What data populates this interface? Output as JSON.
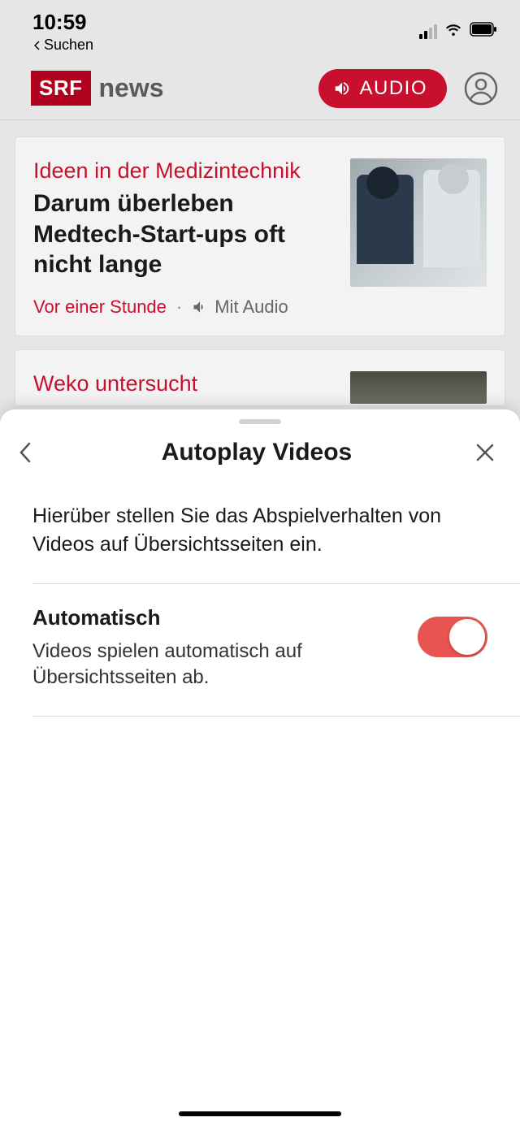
{
  "status": {
    "time": "10:59",
    "back_label": "Suchen"
  },
  "header": {
    "logo_box": "SRF",
    "logo_text": "news",
    "audio_label": "AUDIO"
  },
  "articles": [
    {
      "kicker": "Ideen in der Medizintechnik",
      "headline": "Darum überleben Medtech-Start-ups oft nicht lange",
      "time": "Vor einer Stunde",
      "audio_label": "Mit Audio"
    },
    {
      "kicker": "Weko untersucht"
    }
  ],
  "sheet": {
    "title": "Autoplay Videos",
    "description": "Hierüber stellen Sie das Abspielverhalten von Videos auf Übersichtsseiten ein.",
    "setting_title": "Automatisch",
    "setting_sub": "Videos spielen automatisch auf Übersichtsseiten ab.",
    "toggle_on": true
  }
}
